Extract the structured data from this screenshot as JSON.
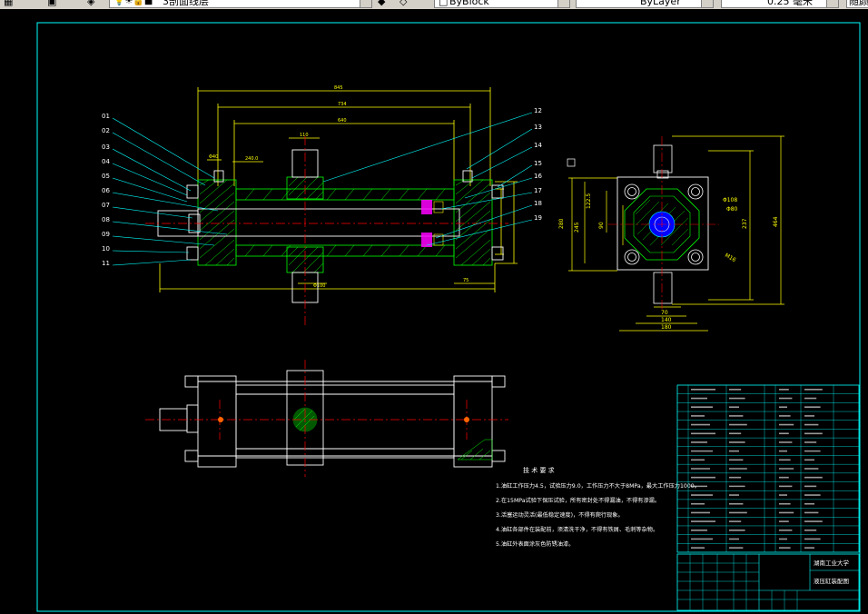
{
  "toolbar": {
    "layer_name": "3剖面线层",
    "color": "ByBlock",
    "linetype": "ByLayer",
    "lineweight": "0.25 毫米",
    "extra": "随颜"
  },
  "callouts_left": [
    "01",
    "02",
    "03",
    "04",
    "05",
    "06",
    "07",
    "08",
    "09",
    "10",
    "11"
  ],
  "callouts_right": [
    "12",
    "13",
    "14",
    "15",
    "16",
    "17",
    "18",
    "19"
  ],
  "notes": {
    "heading": "技 术 要 求",
    "items": [
      "1.油缸工作压力4.5，试验压力9.0，工作压力不大于8MPa，最大工作压力1000。",
      "2.在15MPa试验下保压试验，所有密封处不得漏油，不得有渗漏。",
      "3.活塞运动灵活(最低稳定速度)，不得有爬行现象。",
      "4.油缸各部件在装配前，须清洗干净，不得有铁屑、毛刺等杂物。",
      "5.油缸外表面涂灰色防锈油漆。"
    ]
  },
  "title_block": {
    "school": "湖南工业大学",
    "drawing": "液压缸装配图"
  },
  "colors": {
    "frame": "#00ffff",
    "outline": "#ffffff",
    "section": "#00ff00",
    "center": "#ff0000",
    "dimension": "#ffff00",
    "seal": "#ff00ff",
    "rod": "#0000ff"
  }
}
